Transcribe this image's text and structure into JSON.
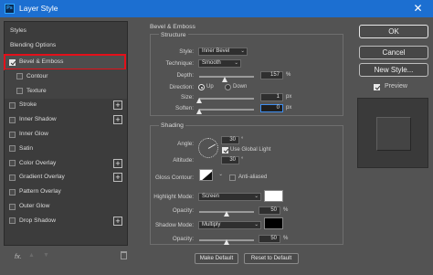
{
  "window": {
    "title": "Layer Style",
    "app_icon": "Ps",
    "close_glyph": "✕"
  },
  "left_panel": {
    "header": "Styles",
    "blending_options": "Blending Options",
    "items": [
      {
        "label": "Bevel & Emboss",
        "checked": true,
        "selected": true,
        "add": false,
        "sub": false
      },
      {
        "label": "Contour",
        "checked": false,
        "selected": false,
        "add": false,
        "sub": true
      },
      {
        "label": "Texture",
        "checked": false,
        "selected": false,
        "add": false,
        "sub": true
      },
      {
        "label": "Stroke",
        "checked": false,
        "selected": false,
        "add": true,
        "sub": false
      },
      {
        "label": "Inner Shadow",
        "checked": false,
        "selected": false,
        "add": true,
        "sub": false
      },
      {
        "label": "Inner Glow",
        "checked": false,
        "selected": false,
        "add": false,
        "sub": false
      },
      {
        "label": "Satin",
        "checked": false,
        "selected": false,
        "add": false,
        "sub": false
      },
      {
        "label": "Color Overlay",
        "checked": false,
        "selected": false,
        "add": true,
        "sub": false
      },
      {
        "label": "Gradient Overlay",
        "checked": false,
        "selected": false,
        "add": true,
        "sub": false
      },
      {
        "label": "Pattern Overlay",
        "checked": false,
        "selected": false,
        "add": false,
        "sub": false
      },
      {
        "label": "Outer Glow",
        "checked": false,
        "selected": false,
        "add": false,
        "sub": false
      },
      {
        "label": "Drop Shadow",
        "checked": false,
        "selected": false,
        "add": true,
        "sub": false
      }
    ],
    "plus_glyph": "+",
    "fx_label": "fx.",
    "up_glyph": "▲",
    "down_glyph": "▼"
  },
  "bevel": {
    "section_title": "Bevel & Emboss",
    "structure_title": "Structure",
    "style_label": "Style:",
    "style_value": "Inner Bevel",
    "technique_label": "Technique:",
    "technique_value": "Smooth",
    "depth_label": "Depth:",
    "depth_value": "157",
    "depth_unit": "%",
    "direction_label": "Direction:",
    "direction_up": "Up",
    "direction_down": "Down",
    "size_label": "Size:",
    "size_value": "1",
    "size_unit": "px",
    "soften_label": "Soften:",
    "soften_value": "0",
    "soften_unit": "px",
    "chevron": "⌄"
  },
  "shading": {
    "title": "Shading",
    "angle_label": "Angle:",
    "angle_value": "30",
    "angle_unit": "°",
    "global_light_label": "Use Global Light",
    "global_light_checked": true,
    "altitude_label": "Altitude:",
    "altitude_value": "30",
    "altitude_unit": "°",
    "gloss_label": "Gloss Contour:",
    "anti_aliased_label": "Anti-aliased",
    "anti_aliased_checked": false,
    "highlight_mode_label": "Highlight Mode:",
    "highlight_mode_value": "Screen",
    "highlight_color": "#ffffff",
    "highlight_opacity_label": "Opacity:",
    "highlight_opacity_value": "50",
    "highlight_opacity_unit": "%",
    "shadow_mode_label": "Shadow Mode:",
    "shadow_mode_value": "Multiply",
    "shadow_color": "#000000",
    "shadow_opacity_label": "Opacity:",
    "shadow_opacity_value": "50",
    "shadow_opacity_unit": "%"
  },
  "buttons": {
    "make_default": "Make Default",
    "reset_default": "Reset to Default",
    "ok": "OK",
    "cancel": "Cancel",
    "new_style": "New Style...",
    "preview_label": "Preview",
    "preview_checked": true
  },
  "colors": {
    "titlebar": "#1c6fd1",
    "selection_outline": "#e3101a",
    "focus": "#3f8ef0"
  }
}
